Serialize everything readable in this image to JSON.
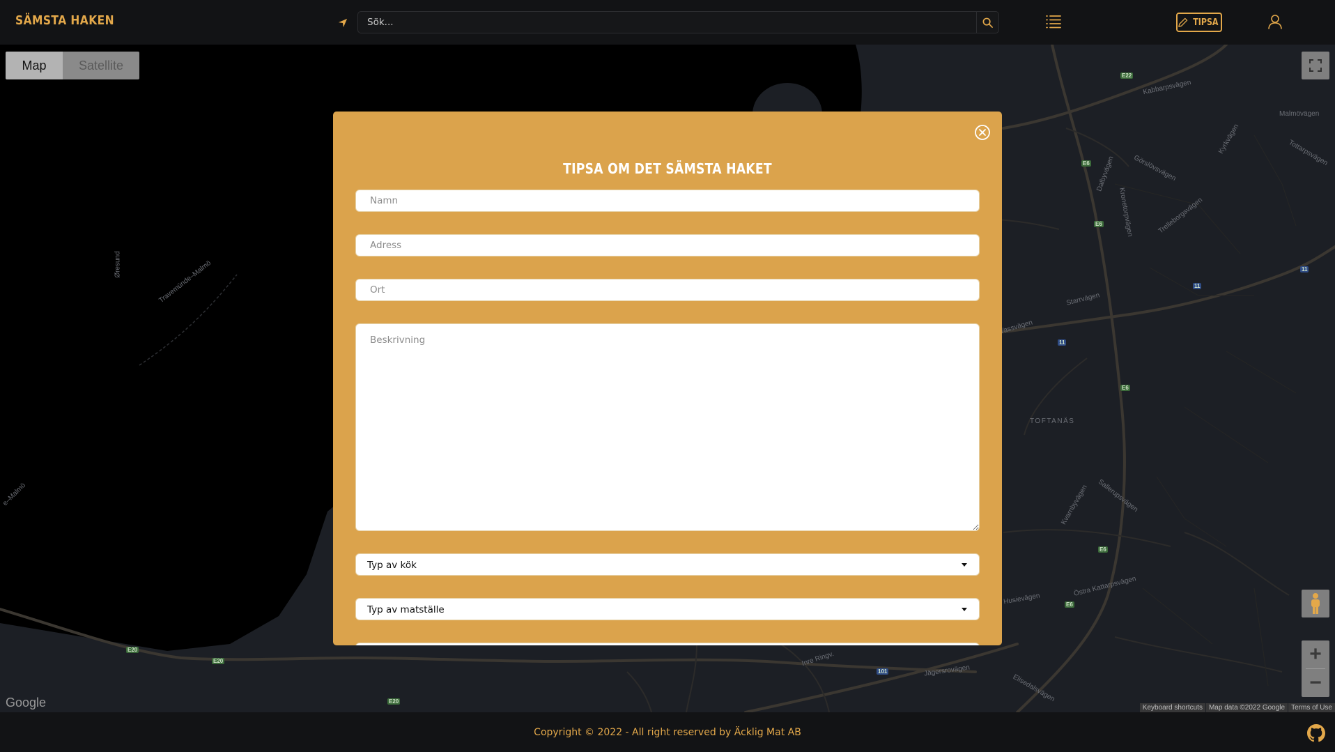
{
  "header": {
    "logo_text": "Sämsta haken",
    "search": {
      "placeholder": "Sök..."
    },
    "tipsa_label": "Tipsa"
  },
  "map": {
    "type_control": {
      "map_label": "Map",
      "satellite_label": "Satellite",
      "selected": "Map"
    },
    "google_label": "Google",
    "attribution": {
      "shortcuts": "Keyboard shortcuts",
      "map_data": "Map data ©2022 Google",
      "terms": "Terms of Use"
    },
    "place_labels": {
      "oresund": "Øresund",
      "tunnel": "Travemünde–Malmö",
      "tunnel2": "e–Malmö",
      "toftanas": "TOFTANÄS",
      "kabbarps": "Kabbarpsvägen",
      "malmovagen": "Malmövägen",
      "goralsvagen": "Görslövsvägen",
      "dalbyvagen": "Dalbyvägen",
      "kronetorp": "Kronetorpvägen",
      "trelleborgs": "Trelleborgsvägen",
      "starrvagen": "Starrvägen",
      "vassvagen": "Vassvägen",
      "sallerupsvagen": "Sallerupsvägen",
      "kvarnby": "Kvarnbyvägen",
      "ostra_kattarp": "Östra Kattarpsvägen",
      "husievagen": "Husievägen",
      "jagersro": "Jägersrovägen",
      "elisedal": "Elisedalsvägen",
      "inre_ring": "Inre Ringv.",
      "torsvagen": "Tottarpsvägen",
      "kyrkvagen": "Kyrkvägen"
    },
    "road_shields": {
      "e22": "E22",
      "e6a": "E6",
      "e6b": "E6",
      "e6c": "E6",
      "e6d": "E6",
      "e6e": "E6",
      "r11a": "11",
      "r11b": "11",
      "r11c": "11",
      "e20a": "E20",
      "e20b": "E20",
      "e20c": "E20",
      "r101": "101"
    }
  },
  "modal": {
    "title": "Tipsa om det sämsta haket",
    "fields": {
      "name_placeholder": "Namn",
      "address_placeholder": "Adress",
      "city_placeholder": "Ort",
      "description_placeholder": "Beskrivning"
    },
    "selects": {
      "cuisine": "Typ av kök",
      "venue": "Typ av matställe"
    }
  },
  "footer": {
    "copyright": "Copyright © 2022 - All right reserved by Äcklig Mat AB"
  },
  "colors": {
    "accent": "#e3a84a",
    "modal_bg": "#dba34c",
    "header_bg": "#121315",
    "map_land": "#1c1f25",
    "map_water": "#000000"
  },
  "icons": {
    "location": "location-arrow-icon",
    "search": "search-icon",
    "list": "list-icon",
    "pencil": "pencil-icon",
    "user": "user-icon",
    "close": "close-circle-icon",
    "github": "github-icon",
    "fullscreen": "fullscreen-icon",
    "pegman": "pegman-icon"
  }
}
